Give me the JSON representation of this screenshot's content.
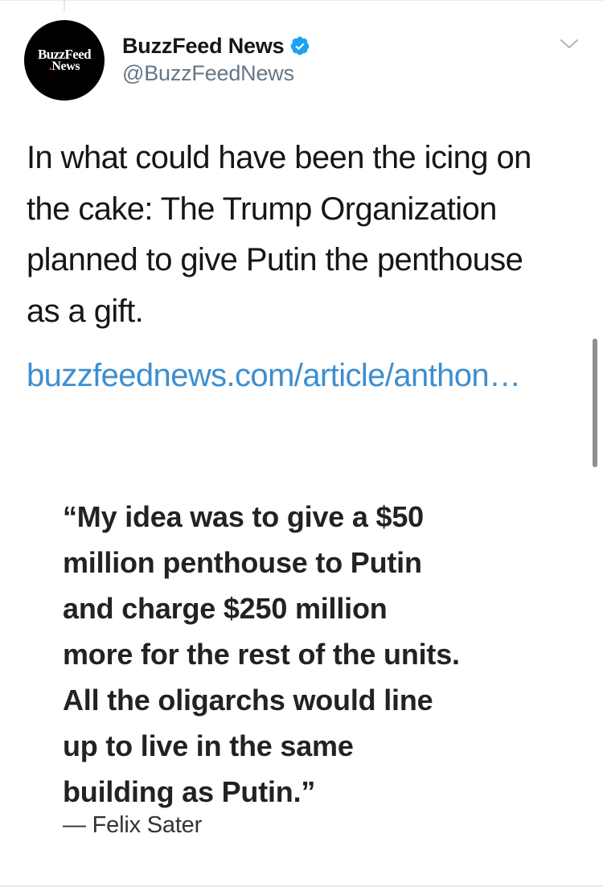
{
  "avatar": {
    "line1": "BuzzFeed",
    "line2_dot": ".",
    "line2_text": "News"
  },
  "header": {
    "display_name": "BuzzFeed News",
    "handle": "@BuzzFeedNews",
    "verified": true,
    "verified_icon": "verified-badge-icon",
    "menu_icon": "chevron-down-icon"
  },
  "tweet": {
    "text": "In what could have been the icing on\nthe cake: The Trump Organization\nplanned to give Putin the penthouse\nas a gift.",
    "link": "buzzfeednews.com/article/anthon…"
  },
  "media": {
    "quote": "“My idea was to give a $50\nmillion penthouse to Putin\nand charge $250 million\nmore for the rest of the units.\nAll the oligarchs would line\nup to live in the same\nbuilding as Putin.”",
    "attribution": "— Felix Sater"
  },
  "colors": {
    "link": "#3d8ed0",
    "verified": "#1da1f2",
    "handle": "#657786",
    "text": "#14171a"
  }
}
